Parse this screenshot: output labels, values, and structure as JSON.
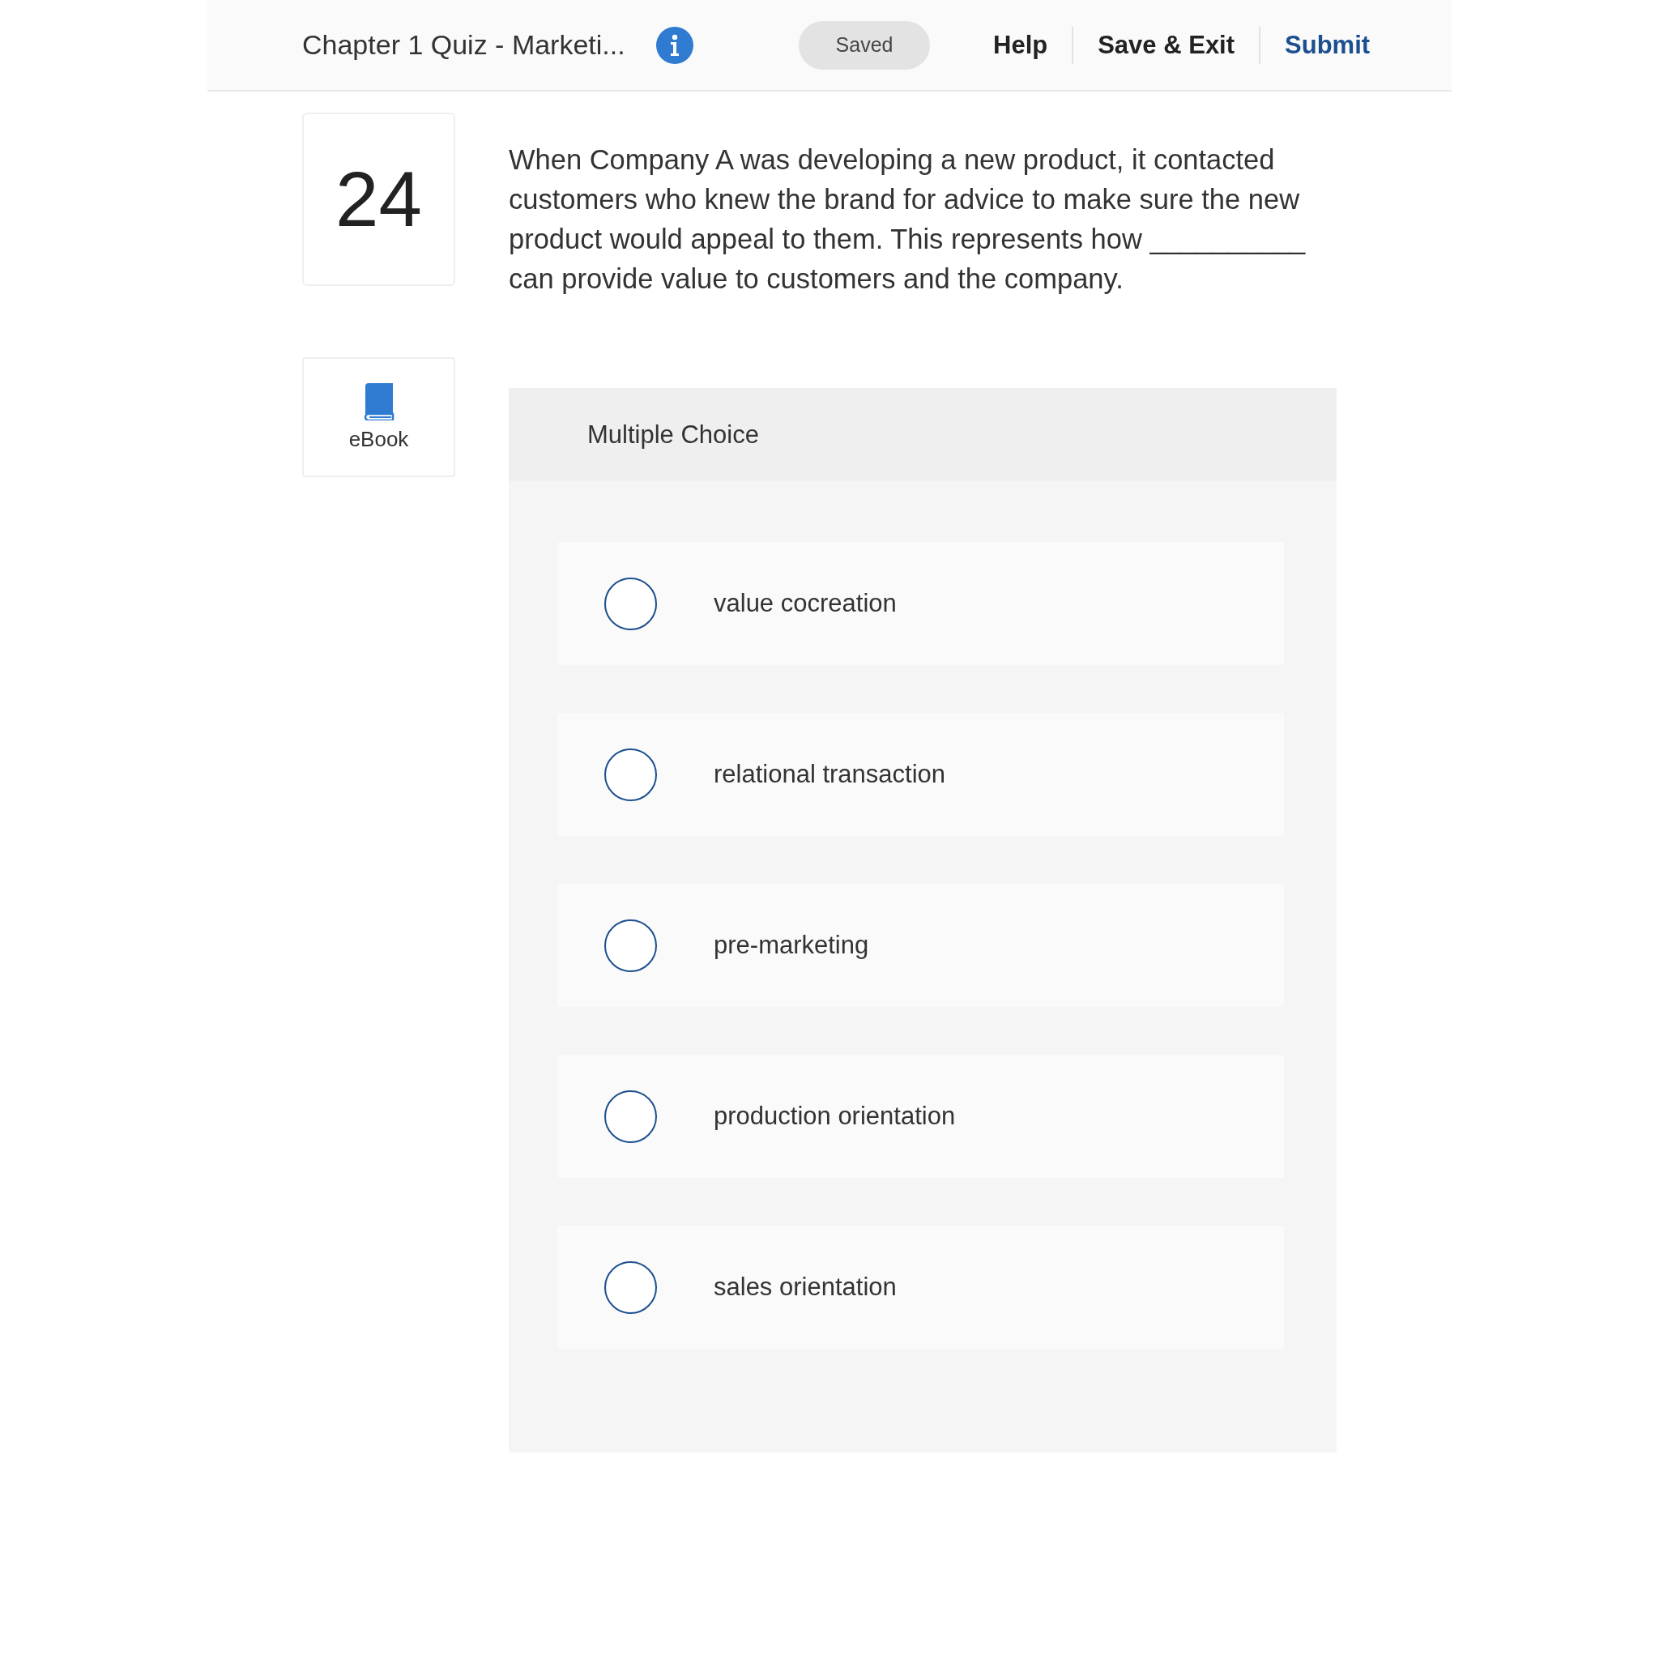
{
  "header": {
    "title": "Chapter 1 Quiz - Marketi...",
    "status": "Saved",
    "links": [
      {
        "label": "Help",
        "kind": "plain"
      },
      {
        "label": "Save & Exit",
        "kind": "plain"
      },
      {
        "label": "Submit",
        "kind": "primary"
      }
    ]
  },
  "question": {
    "number": "24",
    "text": "When Company A was developing a new product, it contacted customers who knew the brand for advice to make sure the new product would appeal to them. This represents how __________ can provide value to customers and the company."
  },
  "ebook": {
    "label": "eBook"
  },
  "answer_panel": {
    "title": "Multiple Choice",
    "options": [
      {
        "label": "value cocreation",
        "selected": false
      },
      {
        "label": "relational transaction",
        "selected": false
      },
      {
        "label": "pre-marketing",
        "selected": false
      },
      {
        "label": "production orientation",
        "selected": false
      },
      {
        "label": "sales orientation",
        "selected": false
      }
    ]
  }
}
